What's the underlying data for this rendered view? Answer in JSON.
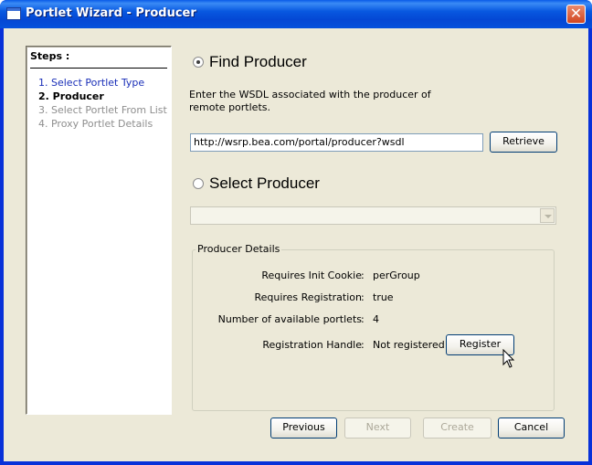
{
  "window": {
    "title": "Portlet Wizard - Producer",
    "close_symbol": "✕"
  },
  "steps": {
    "title": "Steps :",
    "items": [
      {
        "label": "1. Select Portlet Type",
        "state": "done"
      },
      {
        "label": "2. Producer",
        "state": "current"
      },
      {
        "label": "3. Select Portlet From List",
        "state": "todo"
      },
      {
        "label": "4. Proxy Portlet Details",
        "state": "todo"
      }
    ]
  },
  "find_producer": {
    "label": "Find Producer",
    "selected": true,
    "description": "Enter the WSDL associated with the producer of remote portlets.",
    "wsdl_value": "http://wsrp.bea.com/portal/producer?wsdl",
    "retrieve_label": "Retrieve"
  },
  "select_producer": {
    "label": "Select Producer",
    "selected": false,
    "value": ""
  },
  "producer_details": {
    "title": "Producer Details",
    "rows": [
      {
        "label": "Requires Init Cookie",
        "value": "perGroup"
      },
      {
        "label": "Requires Registration",
        "value": "true"
      },
      {
        "label": "Number of available portlets",
        "value": "4"
      },
      {
        "label": "Registration Handle",
        "value": "Not registered"
      }
    ],
    "colon": ":",
    "register_label": "Register"
  },
  "footer": {
    "previous_label": "Previous",
    "next_label": "Next",
    "create_label": "Create",
    "cancel_label": "Cancel"
  },
  "colors": {
    "title_bar": "#0858e0",
    "step_done": "#1a2fb8",
    "step_todo": "#8e8e8e",
    "dialog_bg": "#ece9d8"
  }
}
